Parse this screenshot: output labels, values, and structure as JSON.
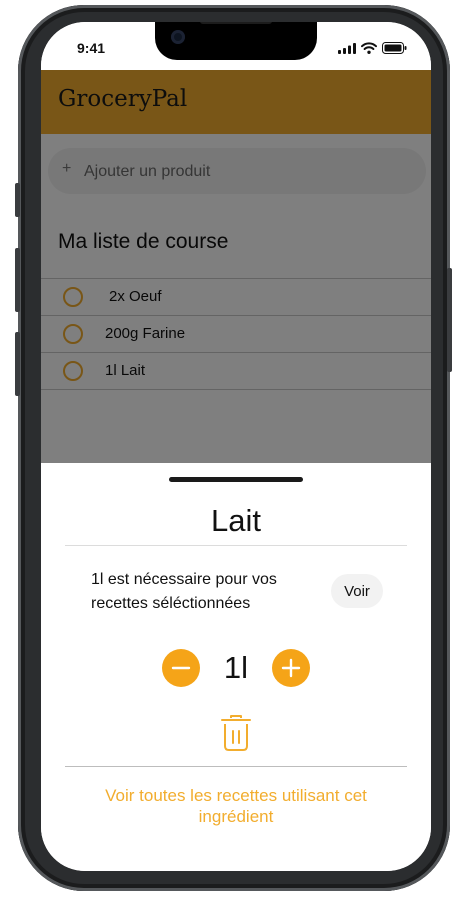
{
  "status_bar": {
    "time": "9:41"
  },
  "app": {
    "title": "GroceryPal"
  },
  "search": {
    "placeholder": "Ajouter un produit"
  },
  "list": {
    "title": "Ma liste de course",
    "items": [
      {
        "label": "2x Oeuf"
      },
      {
        "label": "200g Farine"
      },
      {
        "label": "1l Lait"
      }
    ]
  },
  "sheet": {
    "title": "Lait",
    "info": "1l est nécessaire pour vos recettes séléctionnées",
    "voir_label": "Voir",
    "quantity": "1l",
    "link_label": "Voir toutes les recettes utilisant cet ingrédient"
  },
  "colors": {
    "accent": "#f2ad2e",
    "button": "#f5a418"
  },
  "icons": [
    "plus-icon",
    "minus-icon",
    "trash-icon",
    "radio-circle-icon",
    "signal-icon",
    "wifi-icon",
    "battery-icon"
  ]
}
